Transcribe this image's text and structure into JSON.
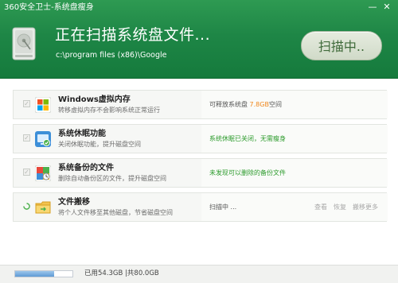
{
  "window": {
    "title": "360安全卫士-系统盘瘦身",
    "minimize_glyph": "—",
    "close_glyph": "✕"
  },
  "header": {
    "scan_title": "正在扫描系统盘文件...",
    "scan_path": "c:\\program files (x86)\\Google",
    "scan_button_label": "扫描中..",
    "disk_icon": "hard-disk-icon"
  },
  "items": [
    {
      "icon": "windows-icon",
      "title": "Windows虚拟内存",
      "desc": "转移虚拟内存不会影响系统正常运行",
      "status_prefix": "可释放系统盘 ",
      "status_highlight": "7.8GB",
      "status_suffix": "空间"
    },
    {
      "icon": "hibernate-icon",
      "title": "系统休眠功能",
      "desc": "关闭休眠功能，提升磁盘空间",
      "status": "系统休眠已关闭，无需瘦身"
    },
    {
      "icon": "backup-icon",
      "title": "系统备份的文件",
      "desc": "删除自动备份区的文件，提升磁盘空间",
      "status": "未发现可以删除的备份文件"
    },
    {
      "icon": "folder-icon",
      "title": "文件搬移",
      "desc": "将个人文件移至其他磁盘，节省磁盘空间",
      "status": "扫描中 ...",
      "actions": [
        "查看",
        "恢复",
        "搬移更多"
      ]
    }
  ],
  "footer": {
    "disk_usage_text": "已用54.3GB |共80.0GB",
    "used_fraction": 0.68
  },
  "colors": {
    "header_green": "#1e8646",
    "highlight_orange": "#f0861a",
    "status_green": "#2c9b2c"
  }
}
